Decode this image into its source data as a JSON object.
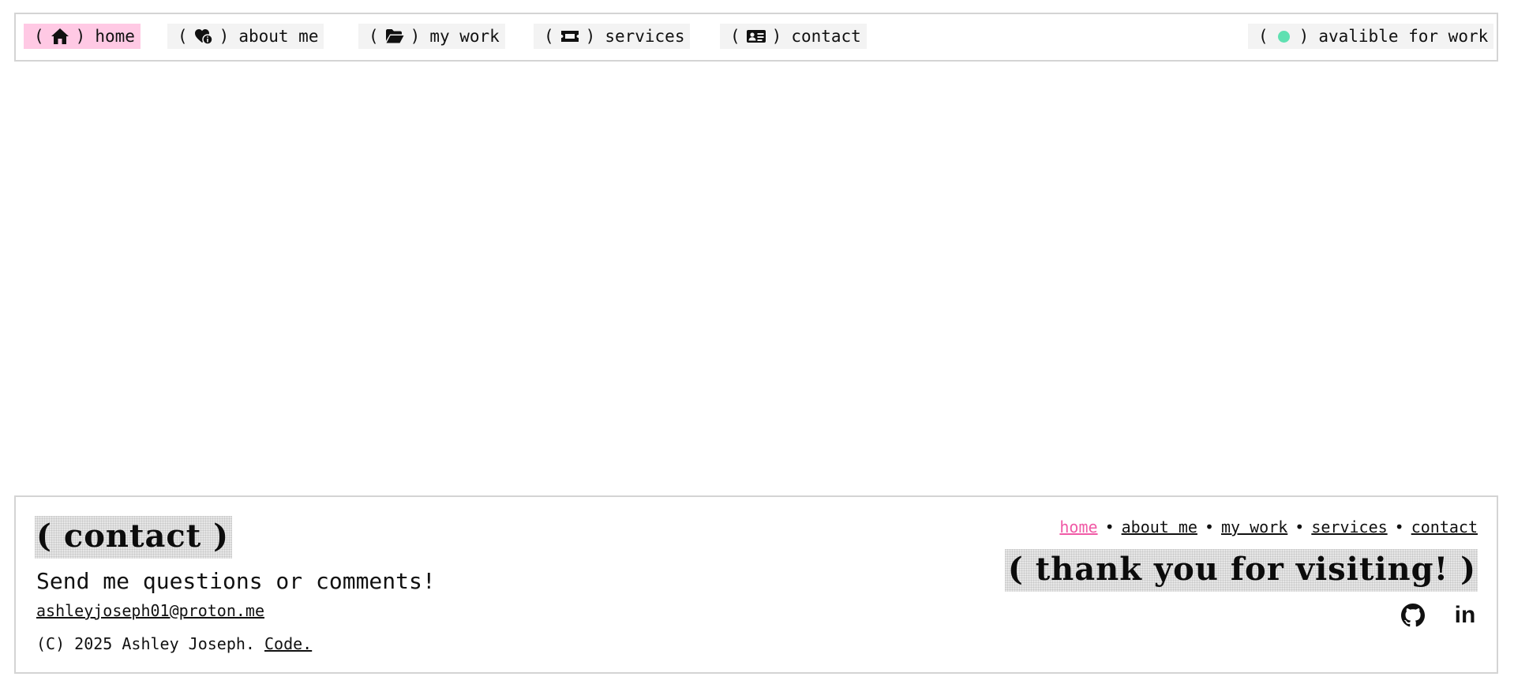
{
  "nav": {
    "items": [
      {
        "label": "home",
        "icon": "house-icon",
        "active": true
      },
      {
        "label": "about me",
        "icon": "heart-info-icon",
        "active": false
      },
      {
        "label": "my work",
        "icon": "folder-open-icon",
        "active": false
      },
      {
        "label": "services",
        "icon": "ticket-icon",
        "active": false
      },
      {
        "label": "contact",
        "icon": "id-card-icon",
        "active": false
      }
    ],
    "status": {
      "label": "avalible for work",
      "dot_color": "#5fe0b1",
      "icon": "status-dot-icon"
    },
    "paren_open": "(",
    "paren_close": ")"
  },
  "footer": {
    "heading": "( contact )",
    "tagline": "Send me questions or comments!",
    "email": "ashleyjoseph01@proton.me",
    "copyright": "(C) 2025 Ashley Joseph.",
    "code_link": "Code.",
    "links": [
      {
        "label": "home",
        "active": true
      },
      {
        "label": "about me",
        "active": false
      },
      {
        "label": "my work",
        "active": false
      },
      {
        "label": "services",
        "active": false
      },
      {
        "label": "contact",
        "active": false
      }
    ],
    "separator": "•",
    "thanks": "( thank you for visiting! )",
    "socials": [
      {
        "name": "github",
        "icon": "github-icon"
      },
      {
        "name": "linkedin",
        "icon": "linkedin-icon",
        "text": "in"
      }
    ]
  },
  "colors": {
    "active_nav_bg": "#ffc9e4",
    "nav_item_bg": "#f3f3f3",
    "active_link": "#f05aa6",
    "border": "#d4d4d4",
    "status_dot": "#5fe0b1"
  }
}
